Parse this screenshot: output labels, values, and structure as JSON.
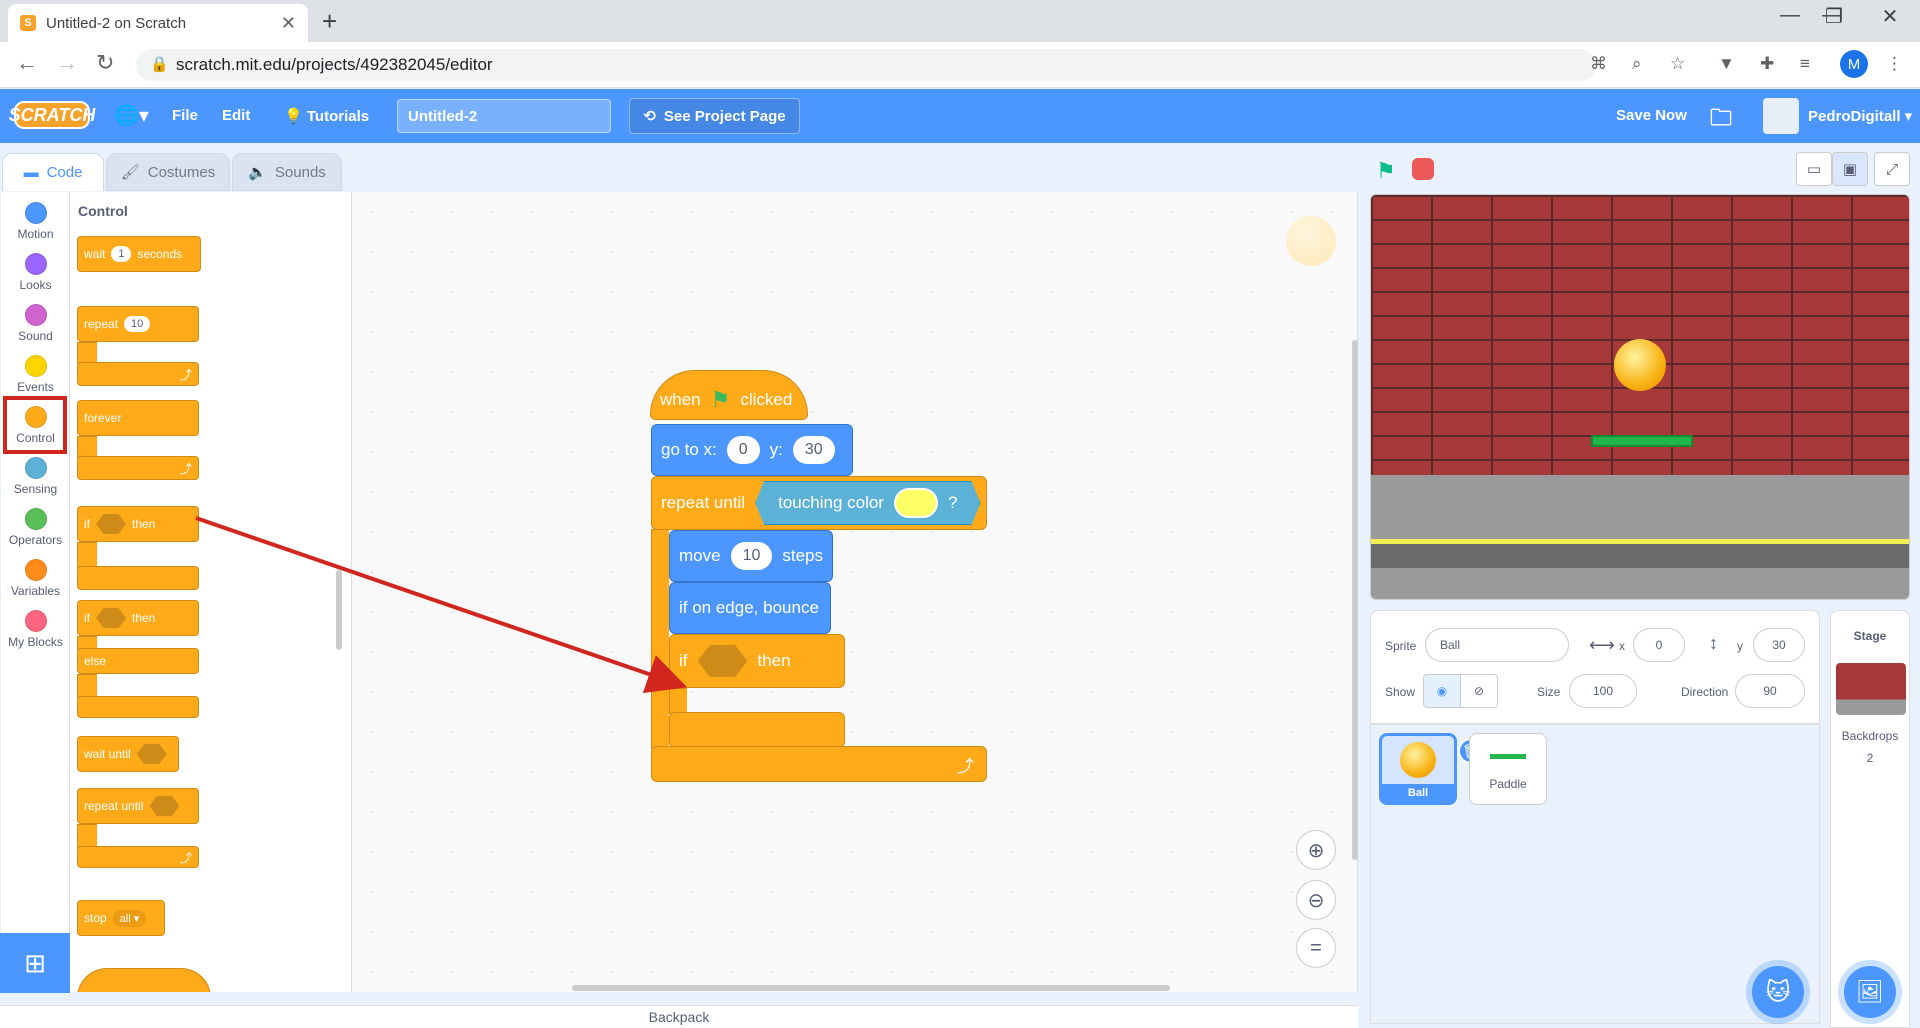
{
  "browser": {
    "tab_title": "Untitled-2 on Scratch",
    "url": "scratch.mit.edu/projects/492382045/editor",
    "profile_letter": "M"
  },
  "menubar": {
    "logo": "SCRATCH",
    "file": "File",
    "edit": "Edit",
    "tutorials": "Tutorials",
    "project_title": "Untitled-2",
    "see_project_page": "See Project Page",
    "save_now": "Save Now",
    "username": "PedroDigitall"
  },
  "tabs": {
    "code": "Code",
    "costumes": "Costumes",
    "sounds": "Sounds"
  },
  "categories": [
    {
      "label": "Motion",
      "color": "#4c97ff"
    },
    {
      "label": "Looks",
      "color": "#9966ff"
    },
    {
      "label": "Sound",
      "color": "#cf63cf"
    },
    {
      "label": "Events",
      "color": "#ffd500"
    },
    {
      "label": "Control",
      "color": "#ffab19"
    },
    {
      "label": "Sensing",
      "color": "#5cb1d6"
    },
    {
      "label": "Operators",
      "color": "#59c059"
    },
    {
      "label": "Variables",
      "color": "#ff8c1a"
    },
    {
      "label": "My Blocks",
      "color": "#ff6680"
    }
  ],
  "palette": {
    "title": "Control",
    "wait": "wait",
    "wait_value": "1",
    "seconds": "seconds",
    "repeat": "repeat",
    "repeat_value": "10",
    "forever": "forever",
    "if": "if",
    "then": "then",
    "if2": "if",
    "then2": "then",
    "else": "else",
    "wait_until": "wait until",
    "repeat_until": "repeat until",
    "stop": "stop",
    "stop_value": "all"
  },
  "script": {
    "when": "when",
    "clicked": "clicked",
    "goto_label": "go to x:",
    "goto_x": "0",
    "y_label": "y:",
    "goto_y": "30",
    "repeat_until": "repeat until",
    "touching_color": "touching color",
    "question": "?",
    "move": "move",
    "move_value": "10",
    "steps": "steps",
    "bounce": "if on edge, bounce",
    "if": "if",
    "then": "then"
  },
  "backpack": "Backpack",
  "sprite_info": {
    "sprite_label": "Sprite",
    "sprite_name": "Ball",
    "x_label": "x",
    "x_value": "0",
    "y_label": "y",
    "y_value": "30",
    "show_label": "Show",
    "size_label": "Size",
    "size_value": "100",
    "direction_label": "Direction",
    "direction_value": "90"
  },
  "sprites": [
    {
      "name": "Ball"
    },
    {
      "name": "Paddle"
    }
  ],
  "stage_panel": {
    "title": "Stage",
    "backdrops_label": "Backdrops",
    "backdrops_count": "2"
  }
}
